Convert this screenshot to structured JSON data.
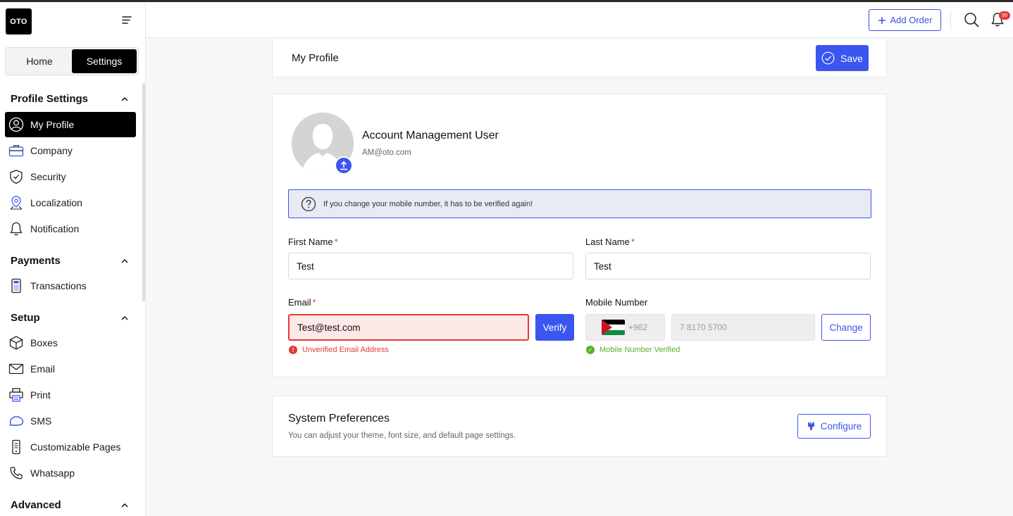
{
  "brand": {
    "logo_text": "OTO"
  },
  "sidebar": {
    "tabs": [
      {
        "label": "Home"
      },
      {
        "label": "Settings",
        "active": true
      }
    ],
    "sections": [
      {
        "title": "Profile Settings",
        "items": [
          {
            "label": "My Profile",
            "icon": "user-circle-icon",
            "active": true
          },
          {
            "label": "Company",
            "icon": "briefcase-icon"
          },
          {
            "label": "Security",
            "icon": "shield-icon"
          },
          {
            "label": "Localization",
            "icon": "map-pin-icon"
          },
          {
            "label": "Notification",
            "icon": "bell-icon"
          }
        ]
      },
      {
        "title": "Payments",
        "items": [
          {
            "label": "Transactions",
            "icon": "calculator-icon"
          }
        ]
      },
      {
        "title": "Setup",
        "items": [
          {
            "label": "Boxes",
            "icon": "box-icon"
          },
          {
            "label": "Email",
            "icon": "mail-icon"
          },
          {
            "label": "Print",
            "icon": "printer-icon"
          },
          {
            "label": "SMS",
            "icon": "sms-icon"
          },
          {
            "label": "Customizable Pages",
            "icon": "phone-icon"
          },
          {
            "label": "Whatsapp",
            "icon": "whatsapp-icon"
          }
        ]
      },
      {
        "title": "Advanced",
        "items": []
      }
    ]
  },
  "topbar": {
    "add_order_label": "Add Order",
    "notification_count": "99"
  },
  "profile": {
    "page_title": "My Profile",
    "save_label": "Save",
    "user_name": "Account Management User",
    "user_email": "AM@oto.com",
    "info_text": "If you change your mobile number, it has to be verified again!"
  },
  "form": {
    "first_name": {
      "label": "First Name",
      "value": "Test"
    },
    "last_name": {
      "label": "Last Name",
      "value": "Test"
    },
    "email": {
      "label": "Email",
      "value": "Test@test.com",
      "status": "Unverified Email Address",
      "verify_label": "Verify"
    },
    "mobile": {
      "label": "Mobile Number",
      "country_code": "+962",
      "number": "7 8170 5700",
      "status": "Mobile Number Verified",
      "change_label": "Change"
    },
    "required_mark": "*"
  },
  "preferences": {
    "title": "System Preferences",
    "subtitle": "You can adjust your theme, font size, and default page settings.",
    "configure_label": "Configure"
  },
  "colors": {
    "accent": "#3b55f0",
    "error": "#e53935",
    "success": "#5cae2f"
  }
}
